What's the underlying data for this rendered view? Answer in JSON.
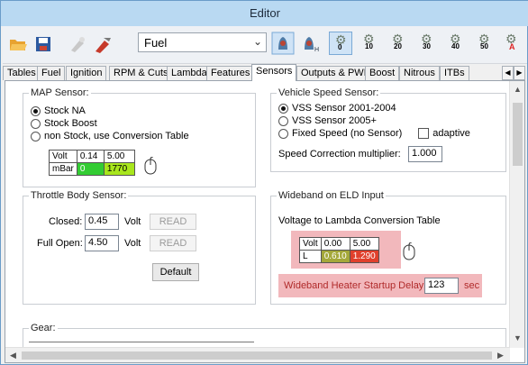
{
  "window": {
    "title": "Editor"
  },
  "toolbar": {
    "config_combo": "Fuel",
    "table_buttons": [
      "0",
      "10",
      "20",
      "30",
      "40",
      "50",
      "A"
    ]
  },
  "tabs": [
    "Tables",
    "Fuel",
    "Ignition",
    "RPM & Cuts",
    "Lambda",
    "Features",
    "Sensors",
    "Outputs & PWM",
    "Boost",
    "Nitrous",
    "ITBs"
  ],
  "active_tab": "Sensors",
  "map_sensor": {
    "title": "MAP Sensor:",
    "options": [
      "Stock NA",
      "Stock Boost",
      "non Stock, use Conversion Table"
    ],
    "selected": "Stock NA",
    "table": {
      "row1_label": "Volt",
      "row1": [
        "0.14",
        "5.00"
      ],
      "row2_label": "mBar",
      "row2": [
        "0",
        "1770"
      ]
    }
  },
  "vss": {
    "title": "Vehicle Speed Sensor:",
    "options": [
      "VSS Sensor 2001-2004",
      "VSS Sensor 2005+",
      "Fixed Speed (no Sensor)"
    ],
    "selected": "VSS Sensor 2001-2004",
    "adaptive_label": "adaptive",
    "adaptive_checked": false,
    "correction_label": "Speed Correction multiplier:",
    "correction_value": "1.000"
  },
  "throttle": {
    "title": "Throttle Body Sensor:",
    "closed_label": "Closed:",
    "closed_value": "0.45",
    "full_open_label": "Full Open:",
    "full_open_value": "4.50",
    "unit": "Volt",
    "read_label": "READ",
    "default_label": "Default"
  },
  "wideband": {
    "title": "Wideband on ELD Input",
    "table_title": "Voltage to Lambda Conversion Table",
    "table": {
      "row1_label": "Volt",
      "row1": [
        "0.00",
        "5.00"
      ],
      "row2_label": "L",
      "row2": [
        "0.610",
        "1.290"
      ]
    },
    "heater_label": "Wideband Heater Startup Delay:",
    "heater_value": "123",
    "heater_unit": "sec"
  },
  "gear": {
    "title": "Gear:"
  },
  "colors": {
    "green_cell": "#33cc33",
    "yellowgreen_cell": "#a8e61d",
    "olive_cell": "#a4a83a",
    "red_cell": "#e0402c",
    "pink_highlight": "#f2b8bc"
  }
}
